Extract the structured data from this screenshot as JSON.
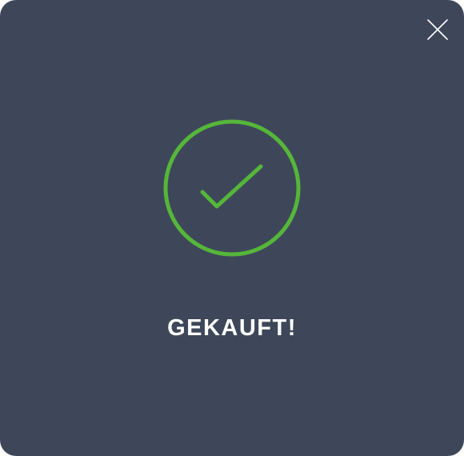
{
  "dialog": {
    "title": "GEKAUFT!",
    "success_icon": "check-circle-icon",
    "close_icon": "close-icon"
  },
  "colors": {
    "background": "#3e4759",
    "accent": "#55b63a",
    "text": "#ffffff"
  }
}
